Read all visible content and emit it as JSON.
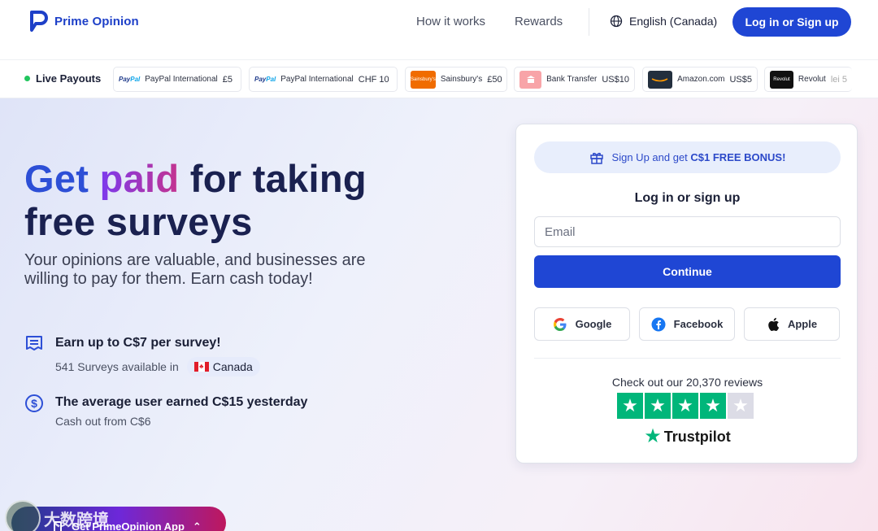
{
  "header": {
    "brand": "Prime Opinion",
    "nav": [
      "How it works",
      "Rewards"
    ],
    "language": "English (Canada)",
    "login_label": "Log in or Sign up"
  },
  "ticker": {
    "live_label": "Live Payouts",
    "payouts": [
      {
        "logo": "PayPal",
        "method": "PayPal International",
        "amount": "£5"
      },
      {
        "logo": "PayPal",
        "method": "PayPal International",
        "amount": "CHF 10"
      },
      {
        "logo": "Sainsbury's",
        "method": "Sainsbury's",
        "amount": "£50"
      },
      {
        "logo": "bank-icon",
        "method": "Bank Transfer",
        "amount": "US$10"
      },
      {
        "logo": "amazon",
        "method": "Amazon.com",
        "amount": "US$5"
      },
      {
        "logo": "Revolut",
        "method": "Revolut",
        "amount": "lei 5"
      }
    ]
  },
  "hero": {
    "headline_get": "Get",
    "headline_paid": "paid",
    "headline_rest1": "for taking",
    "headline_rest2": "free surveys",
    "subhead": "Your opinions are valuable, and businesses are willing to pay for them. Earn cash today!",
    "feature1_title": "Earn up to C$7 per survey!",
    "feature1_sub": "541 Surveys available in",
    "country": "Canada",
    "feature2_title": "The average user earned C$15 yesterday",
    "feature2_sub": "Cash out from C$6",
    "app_bar_label": "Get PrimeOpinion App",
    "watermark": "大数跨境"
  },
  "card": {
    "bonus_prefix": "Sign Up and get",
    "bonus_bold": "C$1 FREE BONUS!",
    "title": "Log in or sign up",
    "email_placeholder": "Email",
    "continue_label": "Continue",
    "social": [
      "Google",
      "Facebook",
      "Apple"
    ],
    "reviews_text": "Check out our 20,370 reviews",
    "rating_stars": 4,
    "rating_max": 5,
    "trustpilot": "Trustpilot"
  },
  "colors": {
    "primary": "#1f46d4",
    "brand_text": "#1e40c8",
    "trustpilot_green": "#00b67a",
    "live_dot": "#22c55e"
  }
}
